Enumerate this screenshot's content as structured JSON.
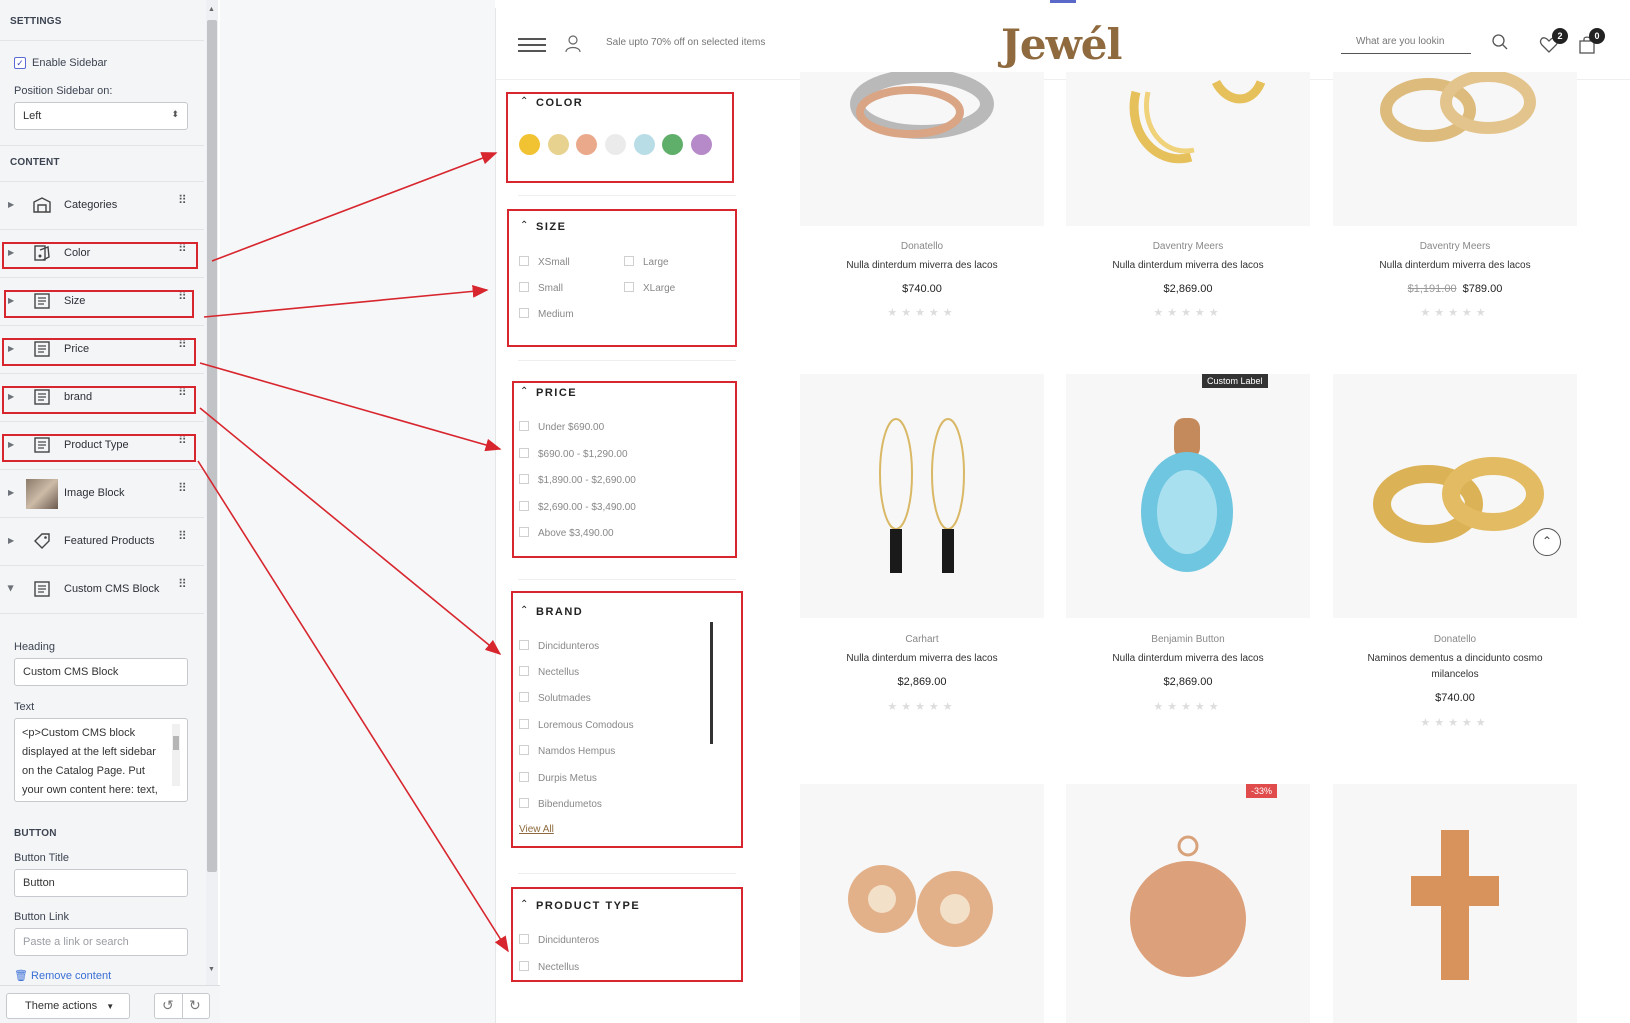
{
  "editor": {
    "settings_heading": "SETTINGS",
    "enable_sidebar_label": "Enable Sidebar",
    "enable_sidebar_checked": true,
    "position_label": "Position Sidebar on:",
    "position_value": "Left",
    "content_heading": "CONTENT",
    "blocks": [
      {
        "label": "Categories",
        "icon": "categories-icon"
      },
      {
        "label": "Color",
        "icon": "color-block-icon"
      },
      {
        "label": "Size",
        "icon": "text-block-icon"
      },
      {
        "label": "Price",
        "icon": "text-block-icon"
      },
      {
        "label": "brand",
        "icon": "text-block-icon"
      },
      {
        "label": "Product Type",
        "icon": "text-block-icon"
      },
      {
        "label": "Image Block",
        "icon": "image-thumbnail"
      },
      {
        "label": "Featured Products",
        "icon": "tag-icon"
      },
      {
        "label": "Custom CMS Block",
        "icon": "text-block-icon"
      }
    ],
    "heading_label": "Heading",
    "heading_value": "Custom CMS Block",
    "text_label": "Text",
    "text_value": "<p>Custom CMS block displayed at the left sidebar on the Catalog Page. Put your own content here: text,",
    "button_heading": "BUTTON",
    "button_title_label": "Button Title",
    "button_title_value": "Button",
    "button_link_label": "Button Link",
    "button_link_placeholder": "Paste a link or search",
    "remove_label": "Remove content",
    "theme_actions_label": "Theme actions"
  },
  "store": {
    "promo": "Sale upto 70% off on selected items",
    "logo": "Jewél",
    "search_placeholder": "What are you lookin",
    "wishlist_count": "2",
    "cart_count": "0"
  },
  "filters": {
    "color": {
      "title": "COLOR",
      "swatches": [
        "#f1c232",
        "#e8d28f",
        "#eba98b",
        "#ebebeb",
        "#b9dde7",
        "#5faf6a",
        "#b68ac9"
      ]
    },
    "size": {
      "title": "SIZE",
      "left": [
        "XSmall",
        "Small",
        "Medium"
      ],
      "right": [
        "Large",
        "XLarge"
      ]
    },
    "price": {
      "title": "PRICE",
      "items": [
        "Under $690.00",
        "$690.00 - $1,290.00",
        "$1,890.00 - $2,690.00",
        "$2,690.00 - $3,490.00",
        "Above $3,490.00"
      ]
    },
    "brand": {
      "title": "BRAND",
      "items": [
        "Dincidunteros",
        "Nectellus",
        "Solutmades",
        "Loremous Comodous",
        "Namdos Hempus",
        "Durpis Metus",
        "Bibendumetos"
      ],
      "view_all": "View All"
    },
    "product_type": {
      "title": "PRODUCT TYPE",
      "items": [
        "Dincidunteros",
        "Nectellus"
      ]
    }
  },
  "products": [
    {
      "brand": "Donatello",
      "name": "Nulla dinterdum miverra des lacos",
      "price": "$740.00",
      "old_price": "",
      "label": ""
    },
    {
      "brand": "Daventry Meers",
      "name": "Nulla dinterdum miverra des lacos",
      "price": "$2,869.00",
      "old_price": "",
      "label": ""
    },
    {
      "brand": "Daventry Meers",
      "name": "Nulla dinterdum miverra des lacos",
      "price": "$789.00",
      "old_price": "$1,191.00",
      "label": ""
    },
    {
      "brand": "Carhart",
      "name": "Nulla dinterdum miverra des lacos",
      "price": "$2,869.00",
      "old_price": "",
      "label": ""
    },
    {
      "brand": "Benjamin Button",
      "name": "Nulla dinterdum miverra des lacos",
      "price": "$2,869.00",
      "old_price": "",
      "label": "Custom Label"
    },
    {
      "brand": "Donatello",
      "name": "Naminos dementus a dincidunto cosmo milancelos",
      "price": "$740.00",
      "old_price": "",
      "label": ""
    },
    {
      "brand": "",
      "name": "",
      "price": "",
      "old_price": "",
      "label": ""
    },
    {
      "brand": "",
      "name": "",
      "price": "",
      "old_price": "",
      "label": "-33%"
    },
    {
      "brand": "",
      "name": "",
      "price": "",
      "old_price": "",
      "label": ""
    }
  ],
  "stars": "★★★★★",
  "colors": {
    "accent_red": "#d7262e",
    "logo_brown": "#8e6a3e",
    "link_blue": "#3a6fd6"
  }
}
